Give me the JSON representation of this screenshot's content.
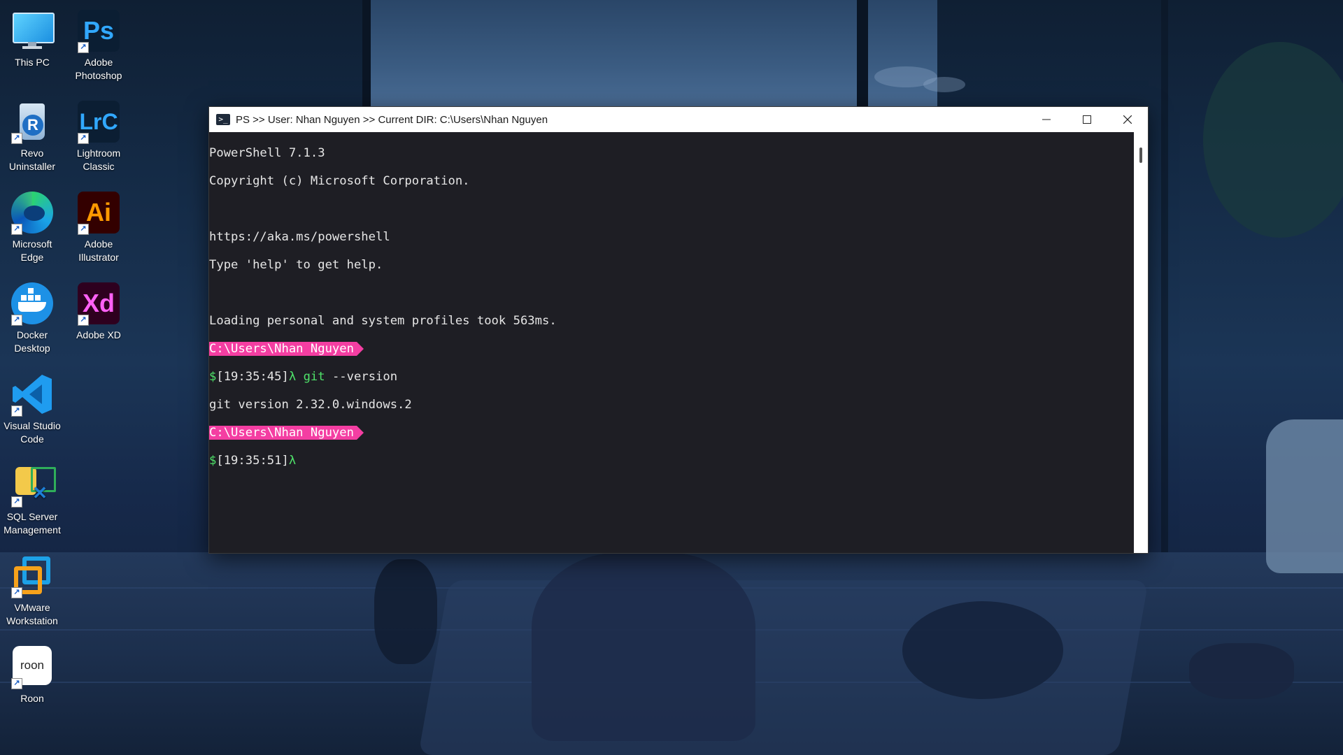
{
  "desktop": {
    "icons": [
      {
        "label": "This PC",
        "icon": "monitor-icon"
      },
      {
        "label": "Adobe Photoshop",
        "icon": "photoshop-icon",
        "glyph": "Ps"
      },
      {
        "label": "Revo Uninstaller",
        "icon": "revo-uninstaller-icon",
        "glyph": "R"
      },
      {
        "label": "Lightroom Classic",
        "icon": "lightroom-icon",
        "glyph": "LrC"
      },
      {
        "label": "Microsoft Edge",
        "icon": "edge-icon"
      },
      {
        "label": "Adobe Illustrator",
        "icon": "illustrator-icon",
        "glyph": "Ai"
      },
      {
        "label": "Docker Desktop",
        "icon": "docker-icon"
      },
      {
        "label": "Adobe XD",
        "icon": "adobe-xd-icon",
        "glyph": "Xd"
      },
      {
        "label": "Visual Studio Code",
        "icon": "vscode-icon"
      },
      {
        "label": "SQL Server Management",
        "icon": "sql-server-icon"
      },
      {
        "label": "VMware Workstation",
        "icon": "vmware-icon"
      },
      {
        "label": "Roon",
        "icon": "roon-icon",
        "glyph": "roon"
      }
    ]
  },
  "terminal": {
    "title": "PS >> User: Nhan Nguyen >> Current DIR: C:\\Users\\Nhan Nguyen",
    "lines": {
      "l1": "PowerShell 7.1.3",
      "l2": "Copyright (c) Microsoft Corporation.",
      "l3": "",
      "l4": "https://aka.ms/powershell",
      "l5": "Type 'help' to get help.",
      "l6": "",
      "l7": "Loading personal and system profiles took 563ms."
    },
    "prompt1": {
      "path": "C:\\Users\\Nhan Nguyen",
      "dollar": "$",
      "time": "[19:35:45]",
      "lambda": "λ",
      "command": "git",
      "args": " --version"
    },
    "output1": "git version 2.32.0.windows.2",
    "prompt2": {
      "path": "C:\\Users\\Nhan Nguyen",
      "dollar": "$",
      "time": "[19:35:51]",
      "lambda": "λ"
    }
  },
  "colors": {
    "prompt_path_bg": "#f43ea2",
    "prompt_green": "#4fe36a",
    "console_bg": "#1e1e24"
  }
}
